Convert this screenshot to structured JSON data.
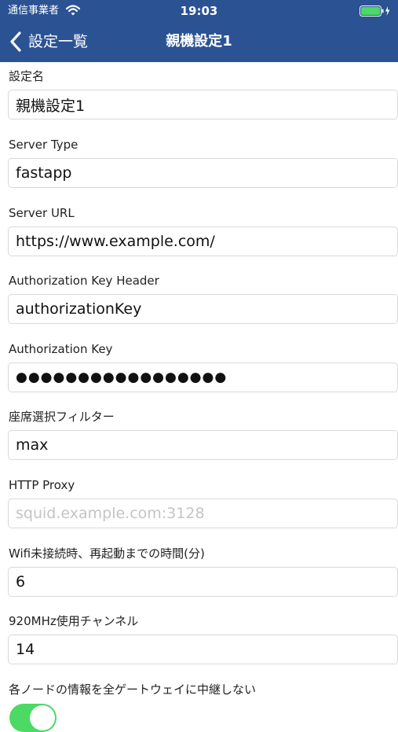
{
  "status_bar": {
    "carrier": "通信事業者",
    "time": "19:03",
    "wifi_icon": "wifi-icon",
    "battery_icon": "battery-charging-icon",
    "battery_color": "#4cd964"
  },
  "nav": {
    "back_label": "設定一覧",
    "title": "親機設定1",
    "background_color": "#2b5394"
  },
  "form": {
    "fields": [
      {
        "label": "設定名",
        "value": "親機設定1",
        "placeholder": ""
      },
      {
        "label": "Server Type",
        "value": "fastapp",
        "placeholder": ""
      },
      {
        "label": "Server URL",
        "value": "https://www.example.com/",
        "placeholder": ""
      },
      {
        "label": "Authorization Key Header",
        "value": "authorizationKey",
        "placeholder": ""
      },
      {
        "label": "Authorization Key",
        "value": "●●●●●●●●●●●●●●●●●",
        "placeholder": ""
      },
      {
        "label": "座席選択フィルター",
        "value": "max",
        "placeholder": ""
      },
      {
        "label": "HTTP Proxy",
        "value": "",
        "placeholder": "squid.example.com:3128"
      },
      {
        "label": "Wifi未接続時、再起動までの時間(分)",
        "value": "6",
        "placeholder": ""
      },
      {
        "label": "920MHz使用チャンネル",
        "value": "14",
        "placeholder": ""
      }
    ],
    "relay_toggle": {
      "label": "各ノードの情報を全ゲートウェイに中継しない",
      "on": true,
      "on_color": "#4cd964"
    }
  }
}
